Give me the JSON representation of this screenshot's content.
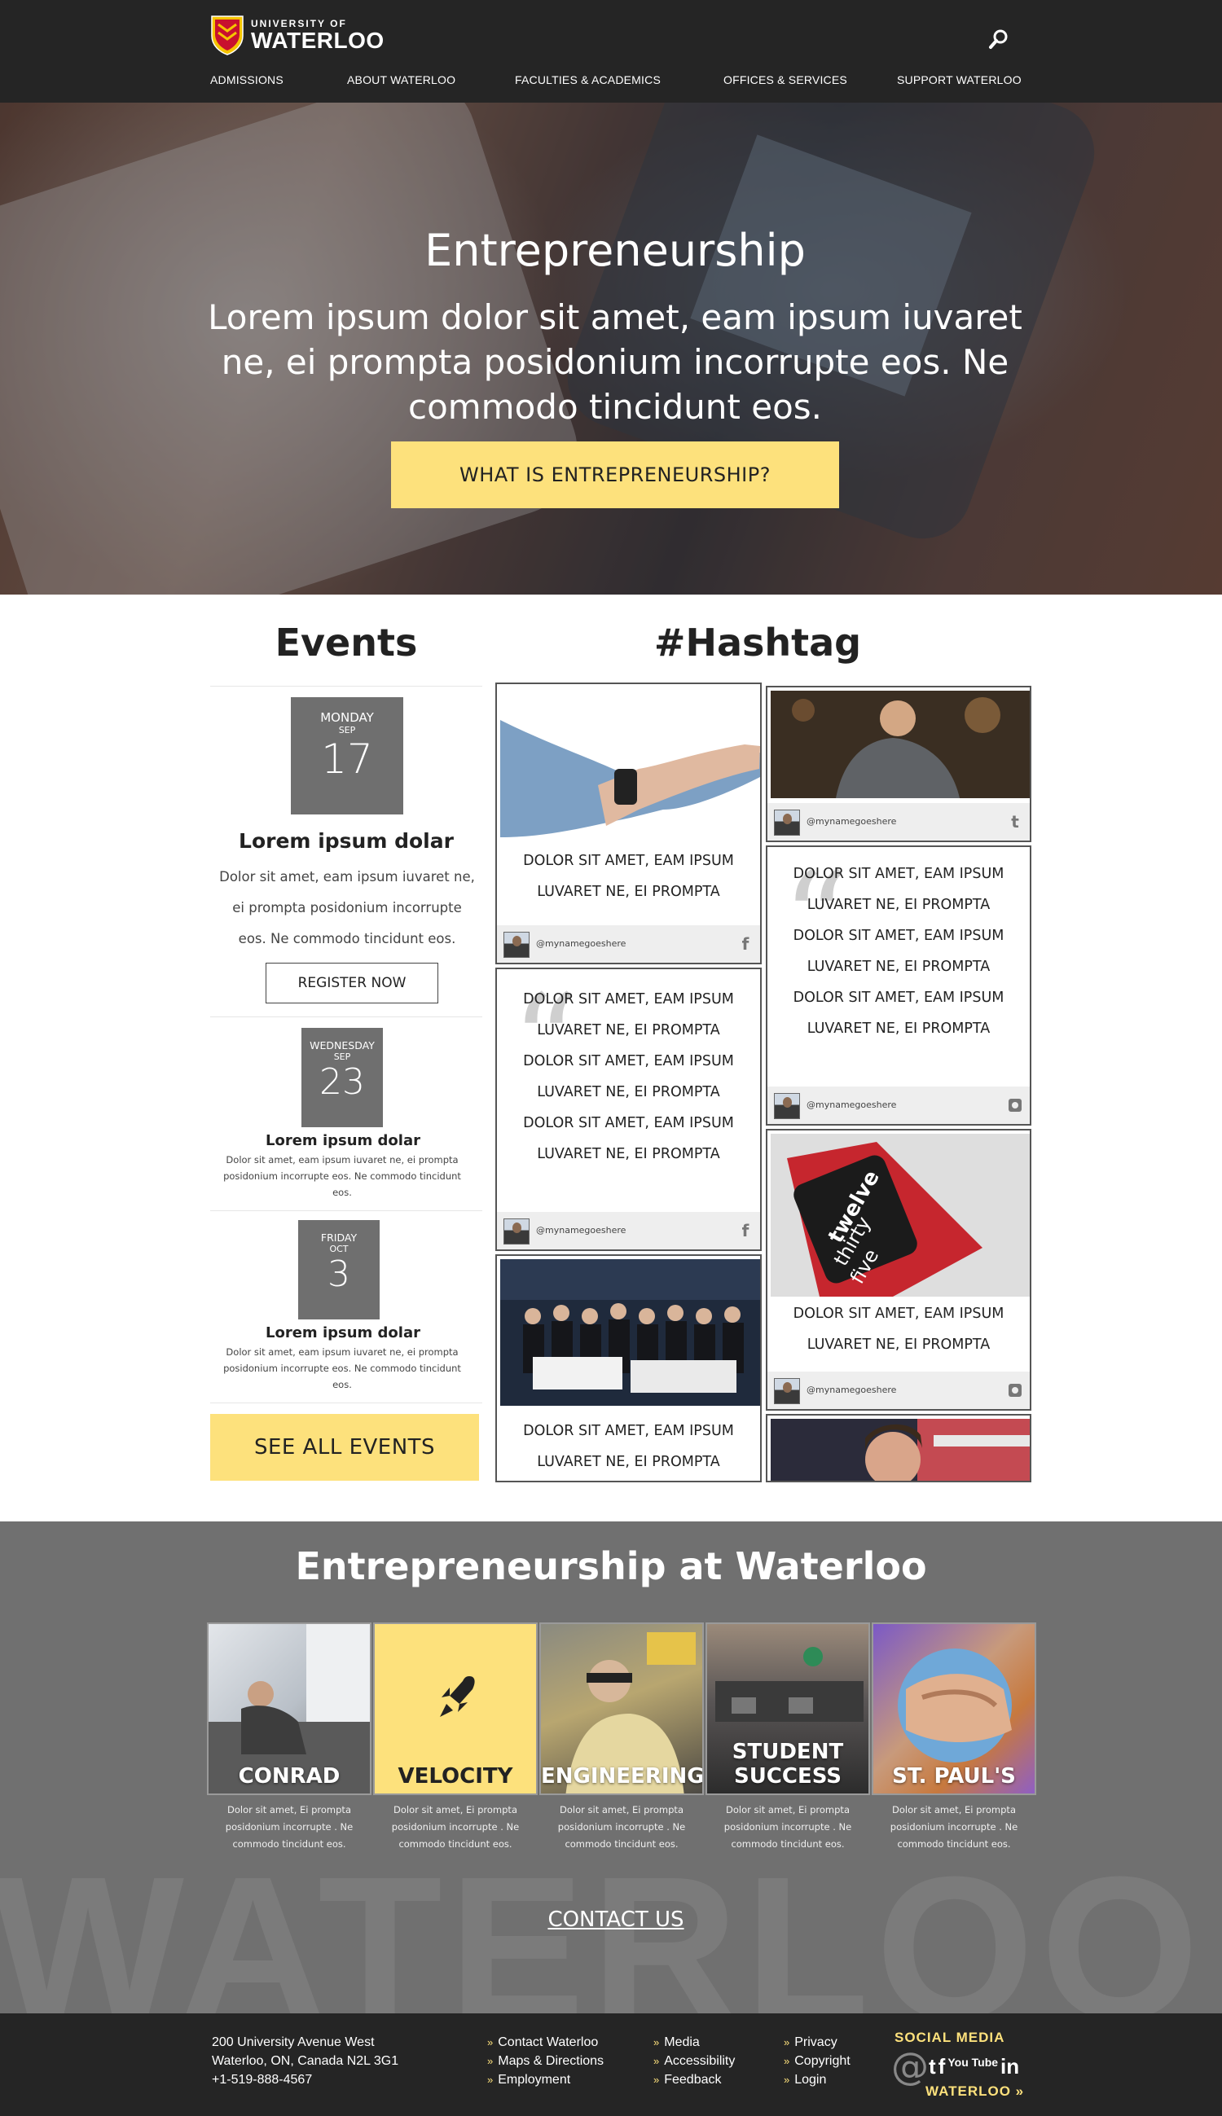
{
  "header": {
    "logo_small": "UNIVERSITY OF",
    "logo_big": "WATERLOO",
    "nav": [
      "ADMISSIONS",
      "ABOUT WATERLOO",
      "FACULTIES & ACADEMICS",
      "OFFICES & SERVICES",
      "SUPPORT WATERLOO"
    ]
  },
  "hero": {
    "title": "Entrepreneurship",
    "subtitle": "Lorem ipsum dolor sit amet, eam ipsum iuvaret ne, ei prompta posidonium incorrupte eos. Ne commodo tincidunt eos.",
    "cta": "WHAT IS ENTREPRENEURSHIP?"
  },
  "events": {
    "title": "Events",
    "items": [
      {
        "day": "MONDAY",
        "month": "SEP",
        "date": "17",
        "title": "Lorem ipsum dolar",
        "desc": "Dolor sit amet, eam ipsum iuvaret ne, ei prompta posidonium incorrupte eos. Ne commodo tincidunt eos.",
        "register": "REGISTER NOW"
      },
      {
        "day": "WEDNESDAY",
        "month": "SEP",
        "date": "23",
        "title": "Lorem ipsum dolar",
        "desc": "Dolor sit amet, eam ipsum iuvaret ne, ei prompta posidonium incorrupte eos. Ne commodo tincidunt eos."
      },
      {
        "day": "FRIDAY",
        "month": "OCT",
        "date": "3",
        "title": "Lorem ipsum dolar",
        "desc": "Dolor sit amet, eam ipsum iuvaret ne, ei prompta posidonium incorrupte eos. Ne commodo tincidunt eos."
      }
    ],
    "see_all": "SEE ALL EVENTS"
  },
  "hashtag": {
    "title": "#Hashtag",
    "username": "@mynamegoeshere",
    "text_line_a": "DOLOR SIT AMET, EAM IPSUM",
    "text_line_b": "LUVARET NE, EI PROMPTA",
    "watch_text": [
      "twelve",
      "thirty",
      "five"
    ],
    "networks": {
      "facebook": "f",
      "twitter": "t",
      "instagram": "instagram"
    }
  },
  "entrepreneurship": {
    "title": "Entrepreneurship at Waterloo",
    "background_word": "WATERLOO",
    "tiles": [
      {
        "label": "CONRAD",
        "desc": "Dolor sit amet, Ei prompta posidonium incorrupte . Ne commodo tincidunt eos."
      },
      {
        "label": "VELOCITY",
        "desc": "Dolor sit amet, Ei prompta posidonium incorrupte . Ne commodo tincidunt eos."
      },
      {
        "label": "ENGINEERING",
        "desc": "Dolor sit amet, Ei prompta posidonium incorrupte . Ne commodo tincidunt eos."
      },
      {
        "label": "STUDENT SUCCESS",
        "desc": "Dolor sit amet, Ei prompta posidonium incorrupte . Ne commodo tincidunt eos."
      },
      {
        "label": "ST. PAUL'S",
        "desc": "Dolor sit amet, Ei prompta posidonium incorrupte . Ne commodo tincidunt eos."
      }
    ],
    "contact": "CONTACT US"
  },
  "footer": {
    "address": [
      "200 University Avenue West",
      "Waterloo, ON, Canada  N2L 3G1",
      "+1-519-888-4567"
    ],
    "col1": [
      "Contact Waterloo",
      "Maps & Directions",
      "Employment"
    ],
    "col2": [
      "Media",
      "Accessibility",
      "Feedback"
    ],
    "col3": [
      "Privacy",
      "Copyright",
      "Login"
    ],
    "social_title": "SOCIAL MEDIA",
    "social_at": "@",
    "social_icons": [
      "t",
      "f",
      "You Tube",
      "in"
    ],
    "social_bottom": "WATERLOO »"
  },
  "colors": {
    "accent": "#fde17c",
    "header_bg": "#252525",
    "section_bg": "#707070",
    "date_box": "#6f6f6f"
  }
}
